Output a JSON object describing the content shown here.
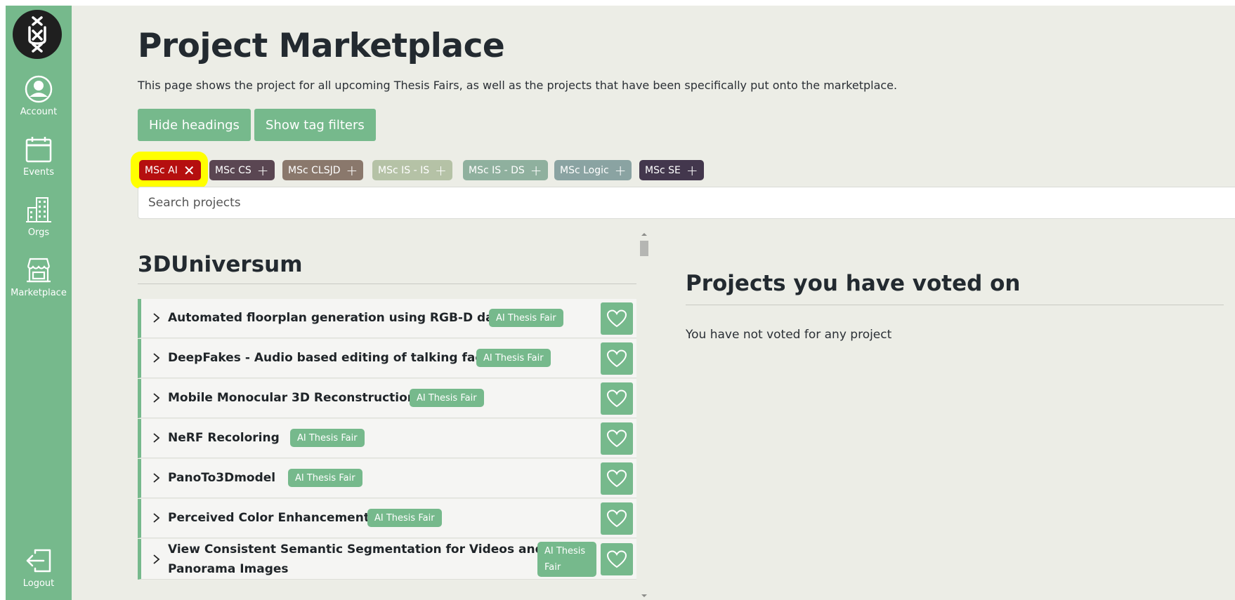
{
  "sidebar": {
    "items": [
      {
        "label": "Account",
        "icon": "account-icon"
      },
      {
        "label": "Events",
        "icon": "calendar-icon"
      },
      {
        "label": "Orgs",
        "icon": "building-icon"
      },
      {
        "label": "Marketplace",
        "icon": "store-icon"
      }
    ],
    "logout_label": "Logout"
  },
  "header": {
    "title": "Project Marketplace",
    "description": "This page shows the project for all upcoming Thesis Fairs, as well as the projects that have been specifically put onto the marketplace."
  },
  "toolbar": {
    "hide_headings_label": "Hide headings",
    "show_tag_filters_label": "Show tag filters"
  },
  "tags": [
    {
      "label": "MSc AI",
      "symbol": "✕",
      "color": "#b50f0f",
      "active": true
    },
    {
      "label": "MSc CS",
      "symbol": "+",
      "color": "#5a4652",
      "active": false
    },
    {
      "label": "MSc CLSJD",
      "symbol": "+",
      "color": "#8a786c",
      "active": false
    },
    {
      "label": "MSc IS - IS",
      "symbol": "+",
      "color": "#b5c2a6",
      "active": false
    },
    {
      "label": "MSc IS - DS",
      "symbol": "+",
      "color": "#8fb09e",
      "active": false
    },
    {
      "label": "MSc Logic",
      "symbol": "+",
      "color": "#8aa3a2",
      "active": false
    },
    {
      "label": "MSc SE",
      "symbol": "+",
      "color": "#43374d",
      "active": false
    }
  ],
  "search": {
    "placeholder": "Search projects"
  },
  "section": {
    "title": "3DUniversum",
    "projects": [
      {
        "title": "Automated floorplan generation using RGB-D data",
        "badge": "AI Thesis Fair"
      },
      {
        "title": "DeepFakes - Audio based editing of talking faces",
        "badge": "AI Thesis Fair"
      },
      {
        "title": "Mobile Monocular 3D Reconstruction",
        "badge": "AI Thesis Fair"
      },
      {
        "title": "NeRF Recoloring",
        "badge": "AI Thesis Fair"
      },
      {
        "title": "PanoTo3Dmodel",
        "badge": "AI Thesis Fair"
      },
      {
        "title": "Perceived Color Enhancement",
        "badge": "AI Thesis Fair"
      },
      {
        "title_line1": "View Consistent Semantic Segmentation for Videos and",
        "title_line2": "Panorama Images",
        "badge_line1": "AI Thesis",
        "badge_line2": "Fair"
      }
    ]
  },
  "voted": {
    "title": "Projects you have voted on",
    "empty_text": "You have not voted for any project"
  },
  "colors": {
    "accent": "#76b98c",
    "background": "#ecede6",
    "highlight": "#ffff00"
  }
}
